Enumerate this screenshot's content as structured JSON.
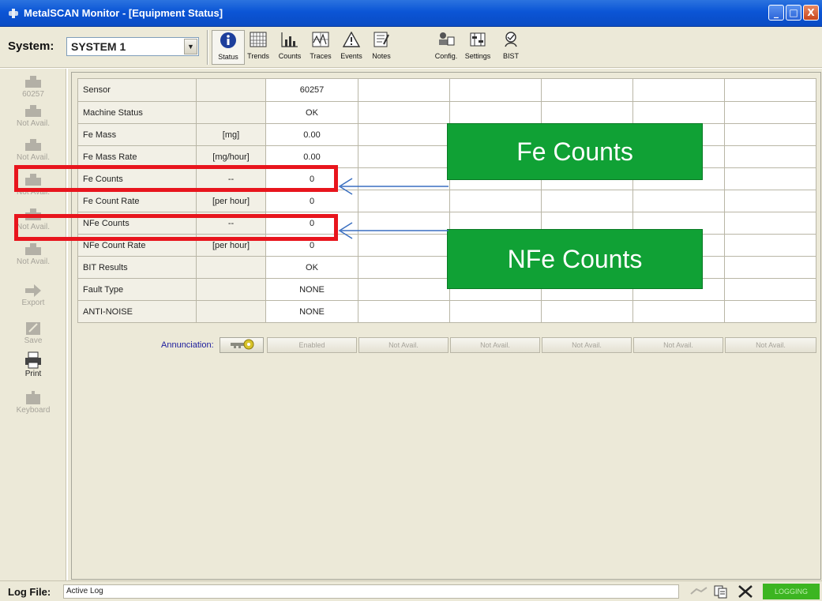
{
  "window": {
    "title": "MetalSCAN Monitor - [Equipment Status]",
    "buttons": [
      "_",
      "□",
      "X"
    ]
  },
  "toolbar": {
    "system_label": "System:",
    "system_value": "SYSTEM 1",
    "buttons": [
      {
        "label": "Status",
        "icon": "info-icon"
      },
      {
        "label": "Trends",
        "icon": "trends-icon"
      },
      {
        "label": "Counts",
        "icon": "counts-icon"
      },
      {
        "label": "Traces",
        "icon": "traces-icon"
      },
      {
        "label": "Events",
        "icon": "warning-icon"
      },
      {
        "label": "Notes",
        "icon": "notes-icon"
      },
      {
        "label": "Config.",
        "icon": "config-icon"
      },
      {
        "label": "Settings",
        "icon": "settings-icon"
      },
      {
        "label": "BIST",
        "icon": "bist-icon"
      }
    ]
  },
  "sidebar": {
    "items": [
      {
        "label": "60257",
        "icon": "sensor-icon"
      },
      {
        "label": "Not Avail.",
        "icon": "sensor-icon"
      },
      {
        "label": "Not Avail.",
        "icon": "sensor-icon"
      },
      {
        "label": "Not Avail.",
        "icon": "sensor-icon"
      },
      {
        "label": "Not Avail.",
        "icon": "sensor-icon"
      },
      {
        "label": "Not Avail.",
        "icon": "sensor-icon"
      },
      {
        "label": "Export",
        "icon": "export-icon"
      },
      {
        "label": "Save",
        "icon": "save-icon"
      },
      {
        "label": "Print",
        "icon": "printer-icon"
      },
      {
        "label": "Keyboard",
        "icon": "keyboard-icon"
      }
    ]
  },
  "table": {
    "rows": [
      {
        "name": "Sensor",
        "unit": "",
        "value": "60257"
      },
      {
        "name": "Machine Status",
        "unit": "",
        "value": "OK"
      },
      {
        "name": "Fe Mass",
        "unit": "[mg]",
        "value": "0.00"
      },
      {
        "name": "Fe Mass Rate",
        "unit": "[mg/hour]",
        "value": "0.00"
      },
      {
        "name": "Fe Counts",
        "unit": "--",
        "value": "0"
      },
      {
        "name": "Fe Count Rate",
        "unit": "[per hour]",
        "value": "0"
      },
      {
        "name": "NFe Counts",
        "unit": "--",
        "value": "0"
      },
      {
        "name": "NFe Count Rate",
        "unit": "[per hour]",
        "value": "0"
      },
      {
        "name": "BIT Results",
        "unit": "",
        "value": "OK"
      },
      {
        "name": "Fault Type",
        "unit": "",
        "value": "NONE"
      },
      {
        "name": "ANTI-NOISE",
        "unit": "",
        "value": "NONE"
      }
    ]
  },
  "annunciation": {
    "label": "Annunciation:",
    "buttons": [
      "Enabled",
      "Not Avail.",
      "Not Avail.",
      "Not Avail.",
      "Not Avail.",
      "Not Avail."
    ]
  },
  "statusbar": {
    "log_label": "Log File:",
    "log_value": "Active Log",
    "logging": "LOGGING"
  },
  "callouts": {
    "fe": "Fe Counts",
    "nfe": "NFe Counts"
  },
  "colors": {
    "callout_green": "#10a135",
    "highlight_red": "#e8151d",
    "titlebar_blue": "#0b55d6",
    "logging_green": "#3cb521"
  }
}
